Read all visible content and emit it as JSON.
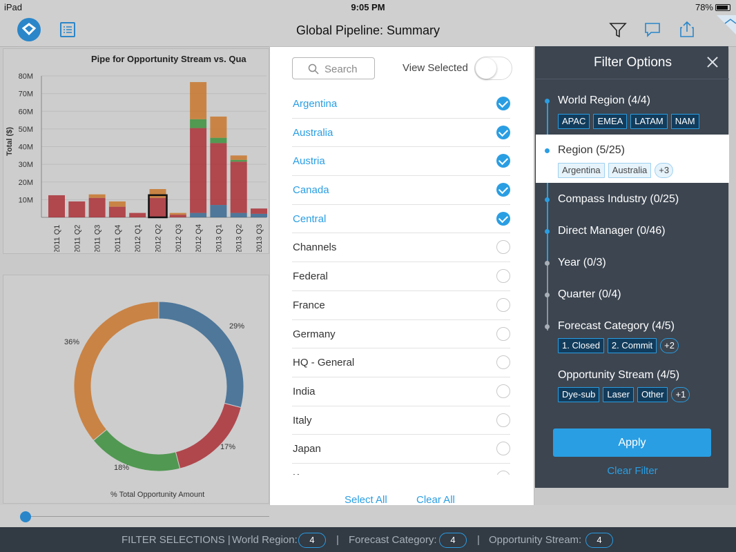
{
  "status_bar": {
    "device": "iPad",
    "time": "9:05 PM",
    "battery": "78%"
  },
  "nav": {
    "title": "Global Pipeline: Summary"
  },
  "background": {
    "chart_title": "Pipe for Opportunity Stream vs. Qua",
    "y_label": "Total ($)",
    "y_ticks": [
      "80M",
      "70M",
      "60M",
      "50M",
      "40M",
      "30M",
      "20M",
      "10M"
    ],
    "x_ticks": [
      "2011 Q1",
      "2011 Q2",
      "2011 Q3",
      "2011 Q4",
      "2012 Q1",
      "2012 Q2",
      "2012 Q3",
      "2012 Q4",
      "2013 Q1",
      "2013 Q2",
      "2013 Q3"
    ],
    "donut_caption": "% Total Opportunity Amount",
    "donut_labels": [
      "29%",
      "17%",
      "18%",
      "36%"
    ]
  },
  "chart_data": [
    {
      "type": "bar",
      "title": "Pipe for Opportunity Stream vs. Qua",
      "ylabel": "Total ($)",
      "ylim": [
        0,
        80
      ],
      "categories": [
        "2011 Q1",
        "2011 Q2",
        "2011 Q3",
        "2011 Q4",
        "2012 Q1",
        "2012 Q2",
        "2012 Q3",
        "2012 Q4",
        "2013 Q1",
        "2013 Q2",
        "2013 Q3"
      ],
      "series": [
        {
          "color": "#2b5f8c",
          "values": [
            0,
            0,
            0,
            0,
            0,
            0,
            0,
            2.5,
            7,
            2.5,
            2
          ]
        },
        {
          "color": "#a8222a",
          "values": [
            12.5,
            9,
            11,
            6,
            2.5,
            11,
            1.5,
            48,
            35,
            29,
            3
          ]
        },
        {
          "color": "#2f8a30",
          "values": [
            0,
            0,
            0,
            0,
            0,
            0,
            0,
            5,
            3,
            1,
            0
          ]
        },
        {
          "color": "#c86f1f",
          "values": [
            0,
            0,
            2,
            3,
            0,
            5,
            1,
            21,
            12,
            2.5,
            0
          ]
        }
      ]
    },
    {
      "type": "pie",
      "title": "% Total Opportunity Amount",
      "values": [
        29,
        17,
        18,
        36
      ],
      "colors": [
        "#2b5f8c",
        "#a8222a",
        "#2f8a30",
        "#c86f1f"
      ]
    }
  ],
  "popover": {
    "search_placeholder": "Search",
    "view_selected_label": "View Selected",
    "items": [
      {
        "label": "Argentina",
        "selected": true
      },
      {
        "label": "Australia",
        "selected": true
      },
      {
        "label": "Austria",
        "selected": true
      },
      {
        "label": "Canada",
        "selected": true
      },
      {
        "label": "Central",
        "selected": true
      },
      {
        "label": "Channels",
        "selected": false
      },
      {
        "label": "Federal",
        "selected": false
      },
      {
        "label": "France",
        "selected": false
      },
      {
        "label": "Germany",
        "selected": false
      },
      {
        "label": "HQ - General",
        "selected": false
      },
      {
        "label": "India",
        "selected": false
      },
      {
        "label": "Italy",
        "selected": false
      },
      {
        "label": "Japan",
        "selected": false
      },
      {
        "label": "Korea",
        "selected": false
      }
    ],
    "select_all": "Select All",
    "clear_all": "Clear All"
  },
  "filter_panel": {
    "title": "Filter Options",
    "items": [
      {
        "name": "World Region (4/4)",
        "chips": [
          "APAC",
          "EMEA",
          "LATAM",
          "NAM"
        ]
      },
      {
        "name": "Region (5/25)",
        "chips": [
          "Argentina",
          "Australia",
          "+3"
        ]
      },
      {
        "name": "Compass Industry (0/25)"
      },
      {
        "name": "Direct Manager (0/46)"
      },
      {
        "name": "Year (0/3)"
      },
      {
        "name": "Quarter (0/4)"
      },
      {
        "name": "Forecast Category (4/5)",
        "chips": [
          "1. Closed",
          "2. Commit",
          "+2"
        ]
      },
      {
        "name": "Opportunity Stream (4/5)",
        "chips": [
          "Dye-sub",
          "Laser",
          "Other",
          "+1"
        ]
      }
    ],
    "apply": "Apply",
    "clear_filter": "Clear Filter"
  },
  "bottom_bar": {
    "label": "FILTER SELECTIONS |",
    "world_region_label": "World Region:",
    "world_region_count": "4",
    "sep1": "|",
    "forecast_label": "Forecast Category:",
    "forecast_count": "4",
    "sep2": "|",
    "stream_label": "Opportunity Stream:",
    "stream_count": "4"
  },
  "colors": {
    "accent": "#2a9ee3",
    "panel": "#3c4550",
    "bar": "#323a44"
  }
}
